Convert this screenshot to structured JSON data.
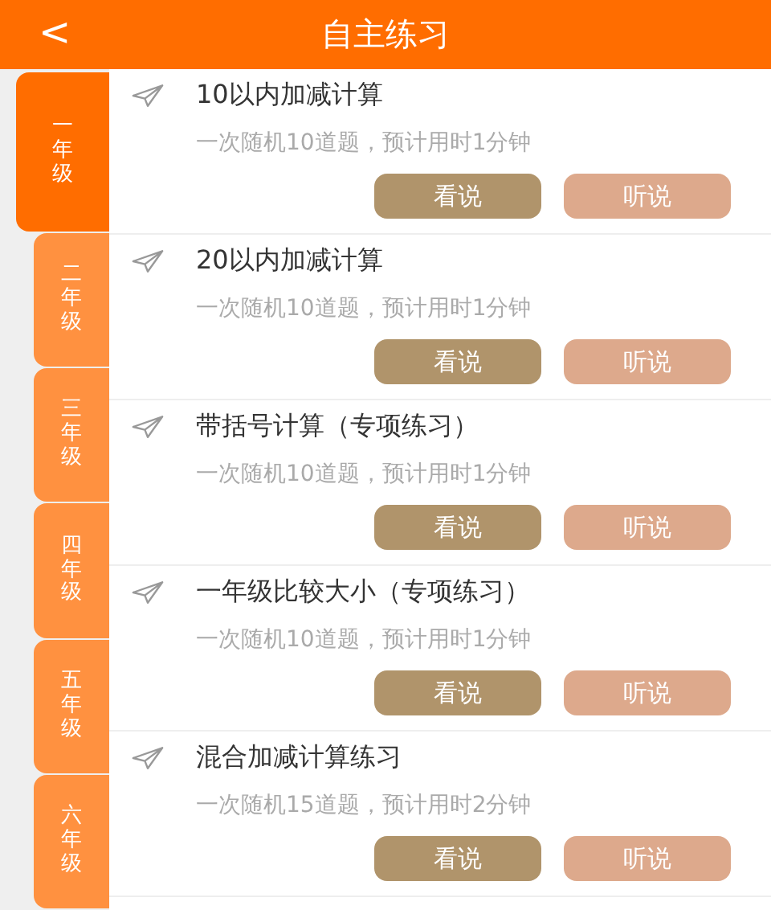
{
  "header": {
    "back": "<",
    "title": "自主练习"
  },
  "grades": [
    {
      "label": "一年级",
      "selected": true
    },
    {
      "label": "二年级",
      "selected": false
    },
    {
      "label": "三年级",
      "selected": false
    },
    {
      "label": "四年级",
      "selected": false
    },
    {
      "label": "五年级",
      "selected": false
    },
    {
      "label": "六年级",
      "selected": false
    }
  ],
  "exercises": [
    {
      "title": "10以内加减计算",
      "description": "一次随机10道题，预计用时1分钟",
      "buttons": [
        "看说",
        "听说"
      ]
    },
    {
      "title": "20以内加减计算",
      "description": "一次随机10道题，预计用时1分钟",
      "buttons": [
        "看说",
        "听说"
      ]
    },
    {
      "title": "带括号计算（专项练习）",
      "description": "一次随机10道题，预计用时1分钟",
      "buttons": [
        "看说",
        "听说"
      ]
    },
    {
      "title": "一年级比较大小（专项练习）",
      "description": "一次随机10道题，预计用时1分钟",
      "buttons": [
        "看说",
        "听说"
      ]
    },
    {
      "title": "混合加减计算练习",
      "description": "一次随机15道题，预计用时2分钟",
      "buttons": [
        "看说",
        "听说"
      ]
    }
  ]
}
